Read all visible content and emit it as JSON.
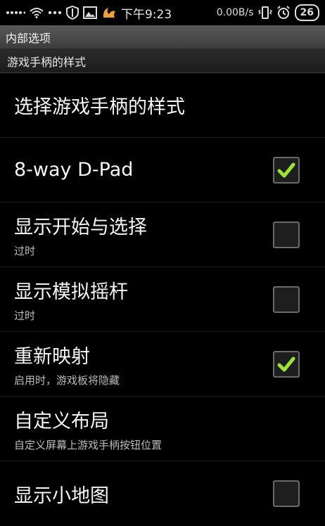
{
  "status_bar": {
    "left_icons": [
      "signal-dots-icon",
      "wifi-icon",
      "dots-icon",
      "shield-icon",
      "image-icon",
      "uc-browser-icon"
    ],
    "time": "下午9:23",
    "net_speed": "0.00B/s",
    "right_icons": [
      "vibrate-icon",
      "alarm-icon"
    ],
    "battery": "26"
  },
  "title_bar": {
    "title": "内部选项"
  },
  "category": {
    "title": "游戏手柄的样式"
  },
  "items": [
    {
      "title": "选择游戏手柄的样式",
      "summary": "",
      "checkbox": false
    },
    {
      "title": "8-way D-Pad",
      "summary": "",
      "checkbox": true,
      "checked": true
    },
    {
      "title": "显示开始与选择",
      "summary": "过时",
      "checkbox": true,
      "checked": false
    },
    {
      "title": "显示模拟摇杆",
      "summary": "过时",
      "checkbox": true,
      "checked": false
    },
    {
      "title": "重新映射",
      "summary": "启用时，游戏板将隐藏",
      "checkbox": true,
      "checked": true
    },
    {
      "title": "自定义布局",
      "summary": "自定义屏幕上游戏手柄按钮位置",
      "checkbox": false
    },
    {
      "title": "显示小地图",
      "summary": "",
      "checkbox": true,
      "checked": false
    }
  ],
  "colors": {
    "check_green": "#9be33a",
    "title_bg": "#4a4a4a"
  }
}
